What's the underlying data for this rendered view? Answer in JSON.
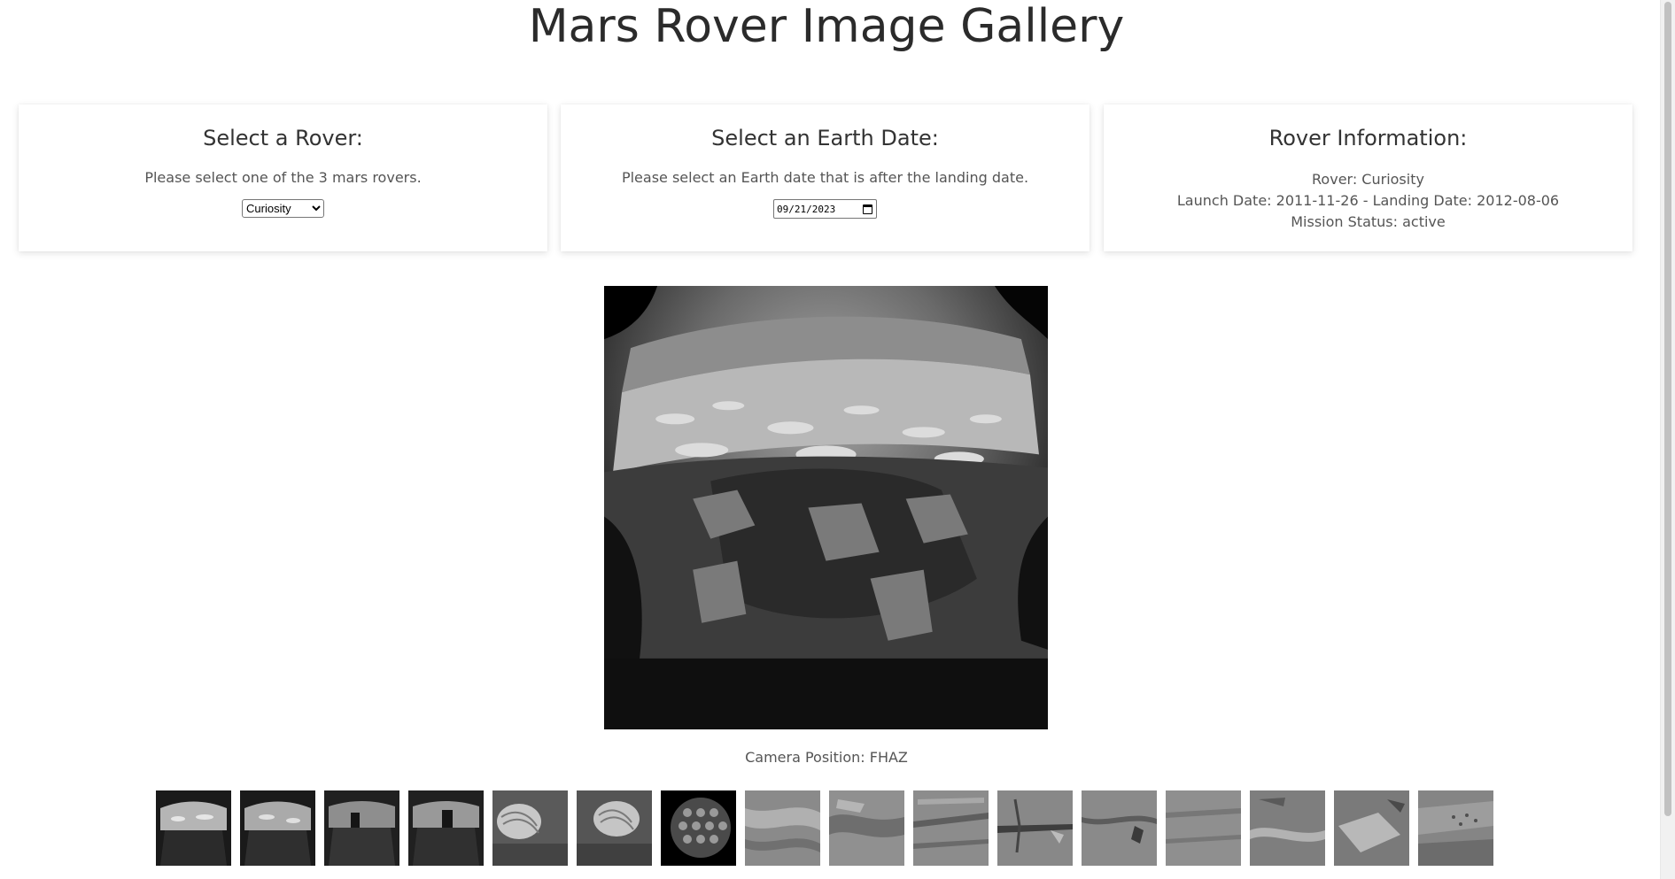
{
  "page": {
    "title": "Mars Rover Image Gallery"
  },
  "rover_card": {
    "heading": "Select a Rover:",
    "description": "Please select one of the 3 mars rovers.",
    "selected": "Curiosity"
  },
  "date_card": {
    "heading": "Select an Earth Date:",
    "description": "Please select an Earth date that is after the landing date.",
    "value": "09/21/2023"
  },
  "info_card": {
    "heading": "Rover Information:",
    "rover_line": "Rover: Curiosity",
    "dates_line": "Launch Date: 2011-11-26 - Landing Date: 2012-08-06",
    "status_line": "Mission Status: active"
  },
  "gallery": {
    "caption": "Camera Position: FHAZ",
    "thumbnail_count": 16
  },
  "colors": {
    "text": "#333333",
    "muted": "#555555",
    "background": "#ffffff"
  }
}
